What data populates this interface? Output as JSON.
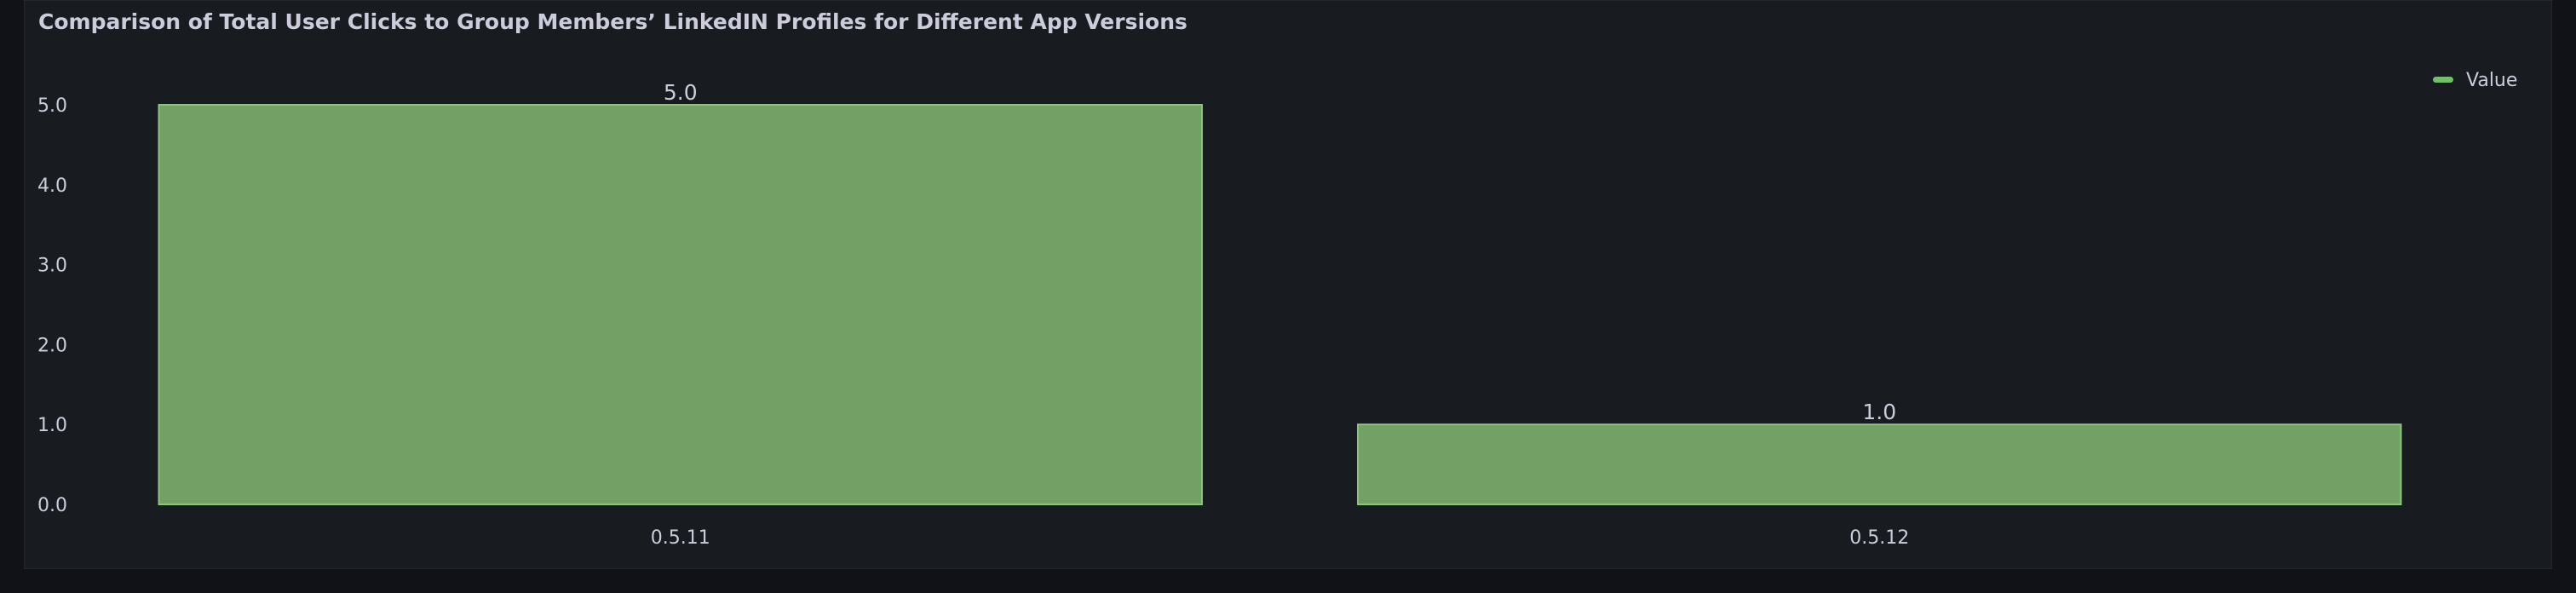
{
  "panel": {
    "title": "Comparison of Total User Clicks to Group Members’ LinkedIN Profiles for Different App Versions"
  },
  "colors": {
    "bar_fill": "#73a064",
    "bar_stroke": "#8bc47a",
    "legend_swatch": "#73bf69",
    "text": "#ccccdc"
  },
  "chart_data": {
    "type": "bar",
    "categories": [
      "0.5.11",
      "0.5.12"
    ],
    "series": [
      {
        "name": "Value",
        "values": [
          5.0,
          1.0
        ]
      }
    ],
    "data_labels": [
      "5.0",
      "1.0"
    ],
    "ylim": [
      0,
      5
    ],
    "yticks": [
      "0.0",
      "1.0",
      "2.0",
      "3.0",
      "4.0",
      "5.0"
    ],
    "grid": false,
    "legend_placement": "top-right",
    "title": "Comparison of Total User Clicks to Group Members’ LinkedIN Profiles for Different App Versions",
    "xlabel": "",
    "ylabel": ""
  }
}
